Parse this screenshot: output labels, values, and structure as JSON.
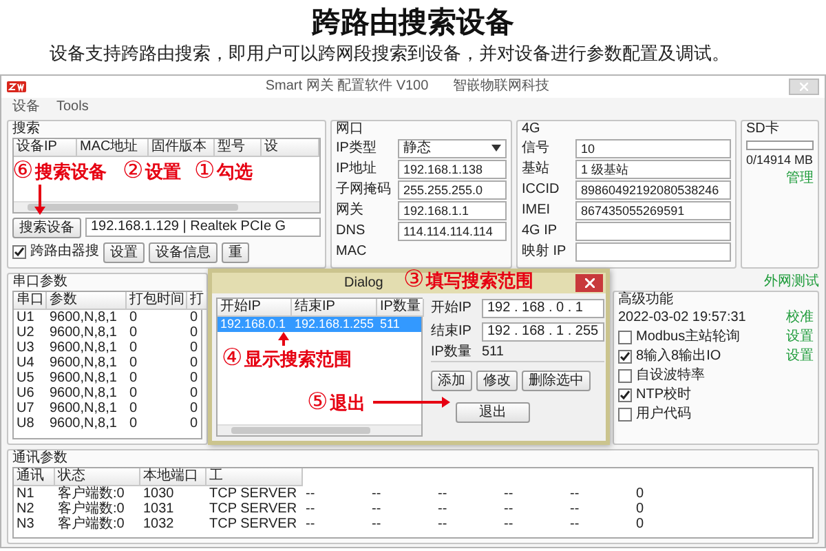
{
  "header": {
    "title": "跨路由搜索设备",
    "description": "设备支持跨路由搜索，即用户可以跨网段搜索到设备，并对设备进行参数配置及调试。"
  },
  "window": {
    "title": "Smart 网关 配置软件 V100",
    "vendor": "智嵌物联网科技"
  },
  "menu": [
    "设备",
    "Tools"
  ],
  "search": {
    "title": "搜索",
    "columns": [
      "设备IP",
      "MAC地址",
      "固件版本",
      "型号",
      "设"
    ],
    "search_button": "搜索设备",
    "adapter": "192.168.1.129 | Realtek PCIe G",
    "router_search": {
      "label": "跨路由器搜",
      "checked": true
    },
    "buttons": [
      "设置",
      "设备信息",
      "重"
    ]
  },
  "network": {
    "title": "网口",
    "fields": [
      {
        "kind": "dropdown",
        "label": "IP类型",
        "value": "静态"
      },
      {
        "kind": "text",
        "label": "IP地址",
        "value": "192.168.1.138"
      },
      {
        "kind": "text",
        "label": "子网掩码",
        "value": "255.255.255.0"
      },
      {
        "kind": "text",
        "label": "网关",
        "value": "192.168.1.1"
      },
      {
        "kind": "text",
        "label": "DNS",
        "value": "114.114.114.114"
      },
      {
        "kind": "label",
        "label": "MAC"
      }
    ]
  },
  "modem": {
    "title": "4G",
    "fields": [
      {
        "label": "信号",
        "value": "10"
      },
      {
        "label": "基站",
        "value": "1 级基站"
      },
      {
        "label": "ICCID",
        "value": "89860492192080538246"
      },
      {
        "label": "IMEI",
        "value": "867435055269591"
      },
      {
        "label": "4G IP"
      },
      {
        "label": "映射 IP"
      }
    ]
  },
  "sd": {
    "title": "SD卡",
    "level": 0,
    "usage": "0/14914 MB",
    "manage": "管理"
  },
  "serial": {
    "title": "串口参数",
    "columns": [
      "串口",
      "参数",
      "打包时间",
      "打"
    ],
    "rows": [
      [
        "U1",
        "9600,N,8,1",
        "0",
        "0"
      ],
      [
        "U2",
        "9600,N,8,1",
        "0",
        "0"
      ],
      [
        "U3",
        "9600,N,8,1",
        "0",
        "0"
      ],
      [
        "U4",
        "9600,N,8,1",
        "0",
        "0"
      ],
      [
        "U5",
        "9600,N,8,1",
        "0",
        "0"
      ],
      [
        "U6",
        "9600,N,8,1",
        "0",
        "0"
      ],
      [
        "U7",
        "9600,N,8,1",
        "0",
        "0"
      ],
      [
        "U8",
        "9600,N,8,1",
        "0",
        "0"
      ]
    ]
  },
  "advanced": {
    "test_link": "外网测试",
    "title": "高级功能",
    "time": "2022-03-02 19:57:31",
    "calibrate": "校准",
    "options": [
      {
        "label": "Modbus主站轮询",
        "checked": false,
        "action": "设置"
      },
      {
        "label": "8输入8输出IO",
        "checked": true,
        "action": "设置"
      },
      {
        "label": "自设波特率",
        "checked": false
      },
      {
        "label": "NTP校时",
        "checked": true
      },
      {
        "label": "用户代码",
        "checked": false
      }
    ]
  },
  "comm": {
    "title": "通讯参数",
    "columns": [
      "通讯",
      "状态",
      "本地端口",
      "工"
    ],
    "rows": [
      [
        "N1",
        "客户端数:0",
        "1030",
        "TCP SERVER",
        "--",
        "--",
        "--",
        "--",
        "--",
        "0"
      ],
      [
        "N2",
        "客户端数:0",
        "1031",
        "TCP SERVER",
        "--",
        "--",
        "--",
        "--",
        "--",
        "0"
      ],
      [
        "N3",
        "客户端数:0",
        "1032",
        "TCP SERVER",
        "--",
        "--",
        "--",
        "--",
        "--",
        "0"
      ]
    ]
  },
  "dialog": {
    "title": "Dialog",
    "columns": [
      "开始IP",
      "结束IP",
      "IP数量"
    ],
    "rows": [
      {
        "cells": [
          "192.168.0.1",
          "192.168.1.255",
          "511"
        ],
        "selected": true
      }
    ],
    "fields": [
      {
        "label": "开始IP",
        "value": "192 . 168 . 0 . 1"
      },
      {
        "label": "结束IP",
        "value": "192 . 168 . 1 . 255"
      }
    ],
    "count_label": "IP数量",
    "count": "511",
    "buttons": [
      "添加",
      "修改",
      "删除选中"
    ],
    "exit": "退出"
  },
  "annotations": [
    {
      "number": "⑥",
      "text": "搜索设备"
    },
    {
      "number": "②",
      "text": "设置"
    },
    {
      "number": "①",
      "text": "勾选"
    },
    {
      "number": "③",
      "text": "填写搜索范围"
    },
    {
      "number": "④",
      "text": "显示搜索范围"
    },
    {
      "number": "⑤",
      "text": "退出"
    }
  ]
}
